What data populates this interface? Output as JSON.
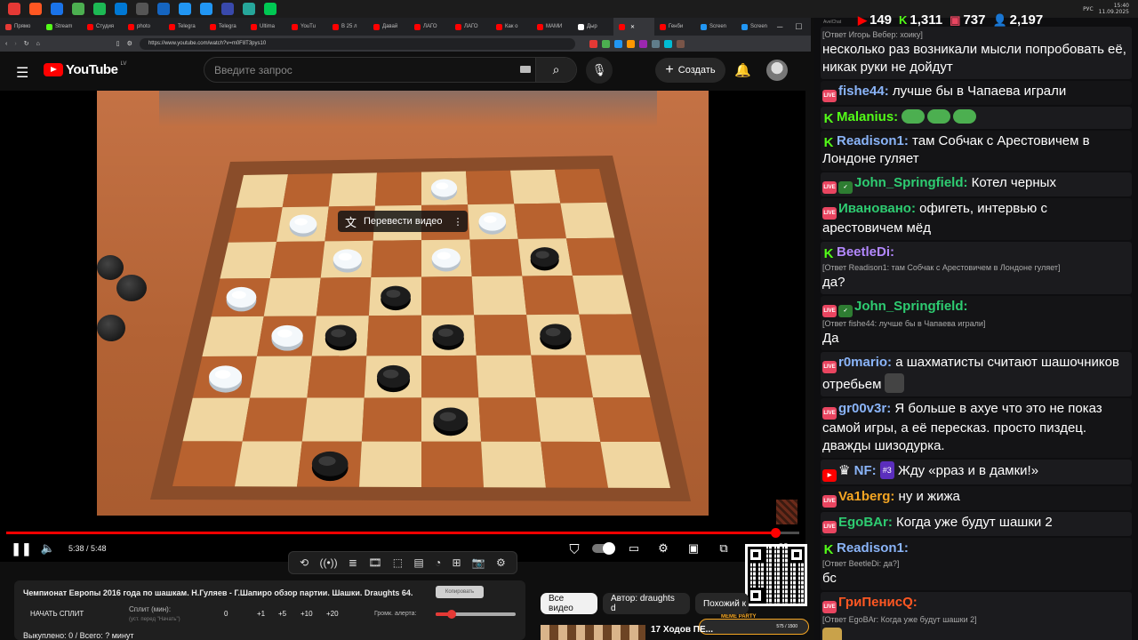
{
  "taskbar": {
    "clock_time": "15:40",
    "clock_date": "11.09.2025",
    "lang": "РУС",
    "app_colors": [
      "#e53935",
      "#ff5722",
      "#1a73e8",
      "#4caf50",
      "#1db954",
      "#0078d4",
      "#555555",
      "#1565c0",
      "#2196f3",
      "#2196f3",
      "#3949ab",
      "#26a69a",
      "#00c853"
    ]
  },
  "stream_stats": {
    "youtube_viewers": "149",
    "kick_viewers": "1,311",
    "live_viewers": "737",
    "total_viewers": "2,197"
  },
  "browser": {
    "tabs": [
      {
        "label": "Прямо",
        "color": "#e53935"
      },
      {
        "label": "Stream",
        "color": "#53fc18"
      },
      {
        "label": "Студия",
        "color": "#ff0000"
      },
      {
        "label": "photo",
        "color": "#ff0000"
      },
      {
        "label": "Telegra",
        "color": "#ff0000"
      },
      {
        "label": "Telegra",
        "color": "#ff0000"
      },
      {
        "label": "Ultima",
        "color": "#ff0000"
      },
      {
        "label": "YouTu",
        "color": "#ff0000"
      },
      {
        "label": "В 25 л",
        "color": "#ff0000"
      },
      {
        "label": "Давай",
        "color": "#ff0000"
      },
      {
        "label": "ЛАГО",
        "color": "#ff0000"
      },
      {
        "label": "ЛАГО",
        "color": "#ff0000"
      },
      {
        "label": "Как о",
        "color": "#ff0000"
      },
      {
        "label": "МАМИ",
        "color": "#ff0000"
      },
      {
        "label": "Дыр",
        "color": "#ffffff"
      },
      {
        "label": "",
        "color": "#ff0000"
      },
      {
        "label": "Генби",
        "color": "#ff0000"
      },
      {
        "label": "Screen",
        "color": "#2196f3"
      },
      {
        "label": "Screen",
        "color": "#2196f3"
      }
    ],
    "url": "https://www.youtube.com/watch?v=m0F8T3pys10"
  },
  "youtube": {
    "wordmark": "YouTube",
    "country": "LV",
    "search_placeholder": "Введите запрос",
    "create_label": "Создать"
  },
  "player": {
    "translate_label": "Перевести видео",
    "current_time": "5:38",
    "duration": "5:48",
    "time_display": "5:38 / 5:48",
    "progress": 0.97
  },
  "board": {
    "white_pieces": [
      [
        "e8",
        0
      ],
      [
        "b7",
        0
      ],
      [
        "f7",
        0
      ],
      [
        "c6",
        0
      ],
      [
        "e6",
        0
      ],
      [
        "a5",
        0
      ],
      [
        "b4",
        0
      ],
      [
        "a3",
        0
      ]
    ],
    "black_pieces": [
      [
        "g6",
        0
      ],
      [
        "d5",
        0
      ],
      [
        "c4",
        0
      ],
      [
        "e4",
        0
      ],
      [
        "g4",
        0
      ],
      [
        "d3",
        0
      ],
      [
        "e2",
        0
      ],
      [
        "c1",
        0
      ]
    ]
  },
  "split": {
    "video_title": "Чемпионат Европы 2016 года по шашкам. Н.Гуляев - Г.Шапиро обзор партии. Шашки. Draughts 64.",
    "copy_label": "Копировать",
    "start_label": "НАЧАТЬ СПЛИТ",
    "split_min_label": "Сплит (мин):",
    "split_hint": "(уст. перед \"Начать\")",
    "split_value": "0",
    "plus1": "+1",
    "plus5": "+5",
    "plus10": "+10",
    "plus20": "+20",
    "alert_label": "Громк. алерта:",
    "alert_level": 0.2,
    "purchased": "Выкуплено: 0 / Всего: ? минут"
  },
  "chips": {
    "all_videos": "Все видео",
    "author": "Автор: draughts d",
    "similar": "Похожий к"
  },
  "recommendation": {
    "title": "17 Ходов ПЕ..."
  },
  "meme": {
    "label": "MEME PARTY",
    "progress": "575 / 1500"
  },
  "chat": {
    "topbar": "AvelChat",
    "messages": [
      {
        "badges": [],
        "user": "",
        "color": "#ffffff",
        "reply": "[Ответ Игорь Вебер: хоику]",
        "text": "несколько раз возникали мысли попробовать её, никак руки не дойдут"
      },
      {
        "badges": [
          "live"
        ],
        "user": "fishe44:",
        "color": "#8ab4f8",
        "reply": "",
        "text": "лучше бы в Чапаева играли"
      },
      {
        "badges": [
          "k"
        ],
        "user": "Malanius:",
        "color": "#53fc18",
        "reply": "",
        "text": ""
      },
      {
        "badges": [
          "k"
        ],
        "user": "Readison1:",
        "color": "#8ab4f8",
        "reply": "",
        "text": "там Собчак с Арестовичем в Лондоне гуляет"
      },
      {
        "badges": [
          "live",
          "check"
        ],
        "user": "John_Springfield:",
        "color": "#2ecc71",
        "reply": "",
        "text": "Котел черных"
      },
      {
        "badges": [
          "live"
        ],
        "user": "Ивановано:",
        "color": "#2ecc71",
        "reply": "",
        "text": "офигеть, интервью с арестовичем мёд"
      },
      {
        "badges": [
          "k"
        ],
        "user": "BeetleDi:",
        "color": "#b388ff",
        "reply": "[Ответ Readison1: там Собчак с Арестовичем в Лондоне гуляет]",
        "text": "да?"
      },
      {
        "badges": [
          "live",
          "check"
        ],
        "user": "John_Springfield:",
        "color": "#2ecc71",
        "reply": "[Ответ fishe44: лучше бы в Чапаева играли]",
        "text": "Да"
      },
      {
        "badges": [
          "live"
        ],
        "user": "r0mario:",
        "color": "#8ab4f8",
        "reply": "",
        "text": "а шахматисты считают шашочников отребьем"
      },
      {
        "badges": [
          "live"
        ],
        "user": "gr00v3r:",
        "color": "#8ab4f8",
        "reply": "",
        "text": "Я больше в ахуе что это не показ самой игры, а её пересказ. просто пиздец. дважды шизодурка."
      },
      {
        "badges": [
          "yt"
        ],
        "user": "NF:",
        "color": "#8ab4f8",
        "reply": "",
        "text": "Жду «рраз и в дамки!»",
        "sub": "#3"
      },
      {
        "badges": [
          "live"
        ],
        "user": "Va1berg:",
        "color": "#f5a623",
        "reply": "",
        "text": "ну и жижа"
      },
      {
        "badges": [
          "live"
        ],
        "user": "EgoBAr:",
        "color": "#2ecc71",
        "reply": "",
        "text": "Когда уже будут шашки 2"
      },
      {
        "badges": [
          "k"
        ],
        "user": "Readison1:",
        "color": "#8ab4f8",
        "reply": "[Ответ BeetleDi: да?]",
        "text": "бс"
      },
      {
        "badges": [
          "live"
        ],
        "user": "ГриПенисQ:",
        "color": "#ff5722",
        "reply": "[Ответ EgoBAr: Когда уже будут шашки 2]",
        "text": ""
      }
    ]
  }
}
